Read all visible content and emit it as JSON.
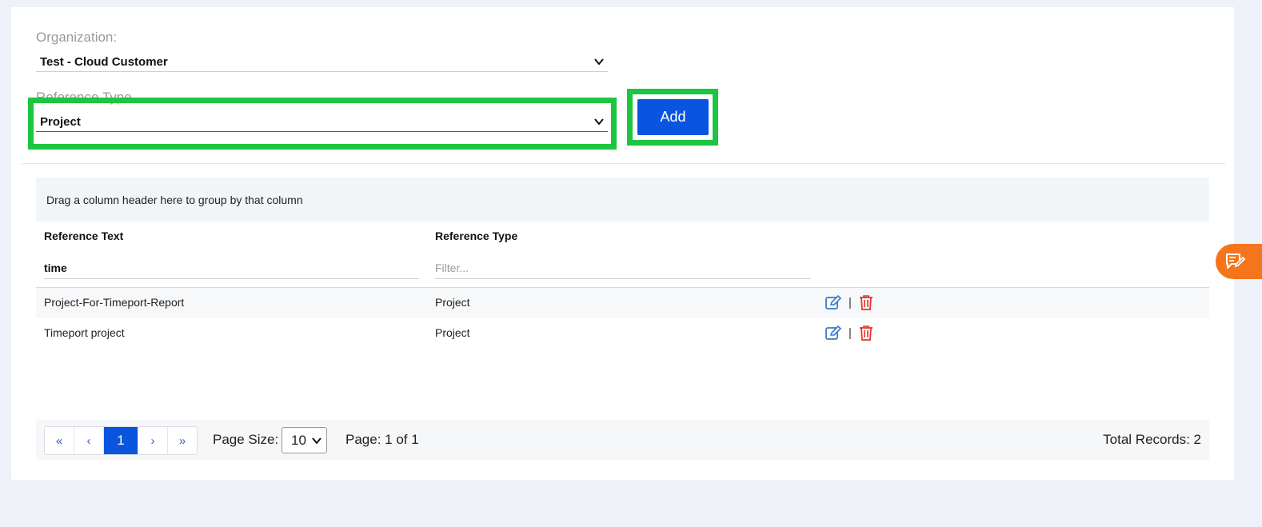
{
  "form": {
    "organization_label": "Organization:",
    "organization_value": "Test - Cloud Customer",
    "reference_type_label": "Reference Type",
    "reference_type_value": "Project",
    "add_label": "Add"
  },
  "grid": {
    "group_hint": "Drag a column header here to group by that column",
    "columns": [
      "Reference Text",
      "Reference Type"
    ],
    "filters": {
      "reference_text_value": "time",
      "reference_type_placeholder": "Filter..."
    },
    "rows": [
      {
        "reference_text": "Project-For-Timeport-Report",
        "reference_type": "Project"
      },
      {
        "reference_text": "Timeport project",
        "reference_type": "Project"
      }
    ],
    "action_separator": "|"
  },
  "pager": {
    "first": "«",
    "prev": "‹",
    "current": "1",
    "next": "›",
    "last": "»",
    "page_size_label": "Page Size:",
    "page_size_value": "10",
    "page_info": "Page: 1 of 1",
    "total_records": "Total Records: 2"
  },
  "colors": {
    "accent": "#0a55e0",
    "highlight": "#1cc640",
    "edit_icon": "#3a78c8",
    "delete_icon": "#e5332a",
    "fab": "#f5751d"
  },
  "icons": {
    "edit": "edit-icon",
    "delete": "trash-icon",
    "feedback": "feedback-icon",
    "dropdown": "chevron-down-icon"
  }
}
